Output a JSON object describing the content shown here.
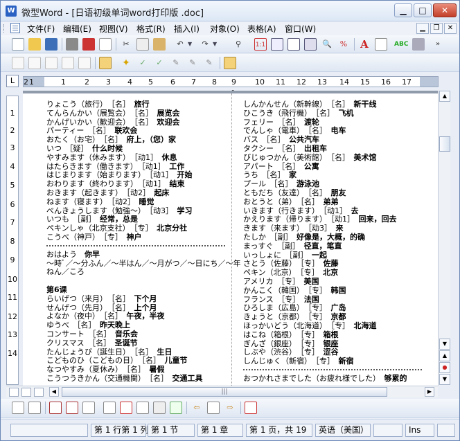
{
  "window": {
    "title": "微型Word - [日语初级单词word打印版 .doc]",
    "icon_label": "W"
  },
  "menubar": {
    "items": [
      "文件(F)",
      "编辑(E)",
      "视图(V)",
      "格式(R)",
      "插入(I)",
      "对象(O)",
      "表格(A)",
      "窗口(W)"
    ]
  },
  "ruler": {
    "numbers": [
      "1",
      "2",
      "1",
      "2",
      "3",
      "4",
      "5",
      "6",
      "7",
      "8",
      "9",
      "10",
      "11",
      "12",
      "13",
      "14",
      "15",
      "16",
      "17"
    ],
    "midmark": "5",
    "corner": "L"
  },
  "vruler": {
    "numbers": [
      "1",
      "2",
      "3",
      "4",
      "5",
      "6",
      "7",
      "8",
      "9",
      "10",
      "11",
      "12",
      "13",
      "14"
    ]
  },
  "document": {
    "left_lines": [
      {
        "t": "りょこう（旅行）　［名］　",
        "b": "旅行"
      },
      {
        "t": "てんらんかい（展覧会）　［名］　",
        "b": "展览会"
      },
      {
        "t": "かんげいかい（歓迎会）　［名］　",
        "b": "欢迎会"
      },
      {
        "t": "パーティー　［名］　",
        "b": "联欢会"
      },
      {
        "t": "おたく（お宅）　［名］　",
        "b": "府上，（您）家"
      },
      {
        "t": "いつ　［疑］　",
        "b": "什么时候"
      },
      {
        "t": "やすみます（休みます）　［动1］　",
        "b": "休息"
      },
      {
        "t": "はたらきます（働きます）　［动1］　",
        "b": "工作"
      },
      {
        "t": "はじまります（始まります）　［动1］　",
        "b": "开始"
      },
      {
        "t": "おわります（終わります）　［动1］　",
        "b": "结束"
      },
      {
        "t": "おきます（起きます）　［动2］　",
        "b": "起床"
      },
      {
        "t": "ねます（寝ます）　［动2］　",
        "b": "睡觉"
      },
      {
        "t": "べんきょうします（勉強～）　［动3］　",
        "b": "学习"
      },
      {
        "t": "いつも　［副］　",
        "b": "经常，总是"
      },
      {
        "t": "ペキンしゃ（北京支社）　［专］　",
        "b": "北京分社"
      },
      {
        "t": "こうべ（神戸）　［专］　",
        "b": "神户"
      },
      {
        "dotted": true
      },
      {
        "t": "おはよう　",
        "b": "你早"
      },
      {
        "t": "～時ﾞ／～分ふん／～半はん／～月がつ／～日にち／～年",
        "b": ""
      },
      {
        "t": "ねん／ころ",
        "b": ""
      },
      {
        "blank": true
      },
      {
        "t": "",
        "b": "第6课"
      },
      {
        "t": "らいげつ（来月）　［名］　",
        "b": "下个月"
      },
      {
        "t": "せんげつ（先月）　［名］　",
        "b": "上个月"
      },
      {
        "t": "よなか（夜中）　［名］　",
        "b": "午夜，半夜"
      },
      {
        "t": "ゆうべ　［名］　",
        "b": "昨天晚上"
      },
      {
        "t": "コンサート　［名］　",
        "b": "音乐会"
      },
      {
        "t": "クリスマス　［名］　",
        "b": "圣诞节"
      },
      {
        "t": "たんじょうび（誕生日）　［名］　",
        "b": "生日"
      },
      {
        "t": "こどものひ（こどもの日）　［名］　",
        "b": "儿童节"
      },
      {
        "t": "なつやすみ（夏休み）　［名］　",
        "b": "暑假"
      },
      {
        "t": "こうつうきかん（交通機関）　［名］　",
        "b": "交通工具"
      }
    ],
    "right_lines": [
      {
        "t": "しんかんせん（新幹線）　［名］　",
        "b": "新干线"
      },
      {
        "t": "ひこうき（飛行機）　［名］　",
        "b": "飞机"
      },
      {
        "t": "フェリー　［名］　",
        "b": "渡轮"
      },
      {
        "t": "でんしゃ（電車）　［名］　",
        "b": "电车"
      },
      {
        "t": "バス　［名］　",
        "b": "公共汽车"
      },
      {
        "t": "タクシー　［名］　",
        "b": "出租车"
      },
      {
        "t": "びじゅつかん（美術館）　［名］　",
        "b": "美术馆"
      },
      {
        "t": "アパート　［名］　",
        "b": "公寓"
      },
      {
        "t": "うち　［名］　",
        "b": "家"
      },
      {
        "t": "プール　［名］　",
        "b": "游泳池"
      },
      {
        "t": "ともだち（友達）　［名］　",
        "b": "朋友"
      },
      {
        "t": "おとうと（弟）　［名］　",
        "b": "弟弟"
      },
      {
        "t": "いきます（行きます）　［动1］　",
        "b": "去"
      },
      {
        "t": "かえります（帰ります）　［动1］　",
        "b": "回来，回去"
      },
      {
        "t": "きます（来ます）　［动3］　",
        "b": "来"
      },
      {
        "t": "たしか　［副］　",
        "b": "好像是，大概，的确"
      },
      {
        "t": "まっすぐ　［副］　",
        "b": "径直，笔直"
      },
      {
        "t": "いっしょに　［副］　",
        "b": "一起"
      },
      {
        "t": "さとう（佐藤）　［专］　",
        "b": "佐藤"
      },
      {
        "t": "ペキン（北京）　［专］　",
        "b": "北京"
      },
      {
        "t": "アメリカ　［专］　",
        "b": "美国"
      },
      {
        "t": "かんこく（韓国）　［专］　",
        "b": "韩国"
      },
      {
        "t": "フランス　［专］　",
        "b": "法国"
      },
      {
        "t": "ひろしま（広島）　［专］　",
        "b": "广岛"
      },
      {
        "t": "きょうと（京都）　［专］　",
        "b": "京都"
      },
      {
        "t": "ほっかいどう（北海道）　［专］　",
        "b": "北海道"
      },
      {
        "t": "はこね（箱根）　［专］　",
        "b": "箱根"
      },
      {
        "t": "ぎんざ（銀座）　［专］　",
        "b": "银座"
      },
      {
        "t": "しぶや（渋谷）　［专］　",
        "b": "涩谷"
      },
      {
        "t": "しんじゅく（新宿）　［专］　",
        "b": "新宿"
      },
      {
        "dotted": true
      },
      {
        "t": "おつかれさまでした（お疲れ様でした）　",
        "b": "够累的"
      }
    ]
  },
  "scroll": {
    "h_thumb_grip": "|||"
  },
  "status": {
    "position": "第 1 行第 1 列",
    "section": "第 1 节",
    "chapter": "第 1 章",
    "page": "第 1 页，共 19",
    "language": "英语（美国）",
    "mode": "Ins"
  }
}
